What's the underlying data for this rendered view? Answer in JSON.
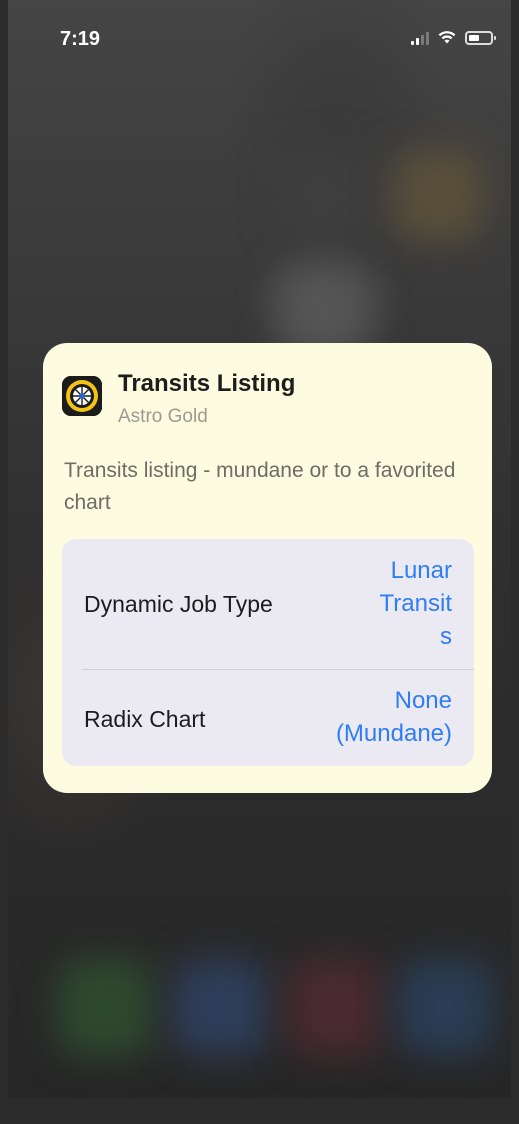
{
  "status_bar": {
    "time": "7:19",
    "signal_icon": "cellular-signal-icon",
    "wifi_icon": "wifi-icon",
    "battery_icon": "battery-icon"
  },
  "shortcut_card": {
    "app_icon": "astro-gold-wheel-icon",
    "title": "Transits Listing",
    "app_name": "Astro Gold",
    "description": "Transits listing - mundane or to a favorited chart",
    "parameters": [
      {
        "label": "Dynamic Job Type",
        "value_lines": [
          "Lunar",
          "Transit",
          "s"
        ]
      },
      {
        "label": "Radix Chart",
        "value_lines": [
          "None",
          "(Mundane)"
        ]
      }
    ]
  },
  "colors": {
    "card_background": "#fdfbe0",
    "params_background": "#ebeaf3",
    "accent_blue": "#2f7df5"
  }
}
